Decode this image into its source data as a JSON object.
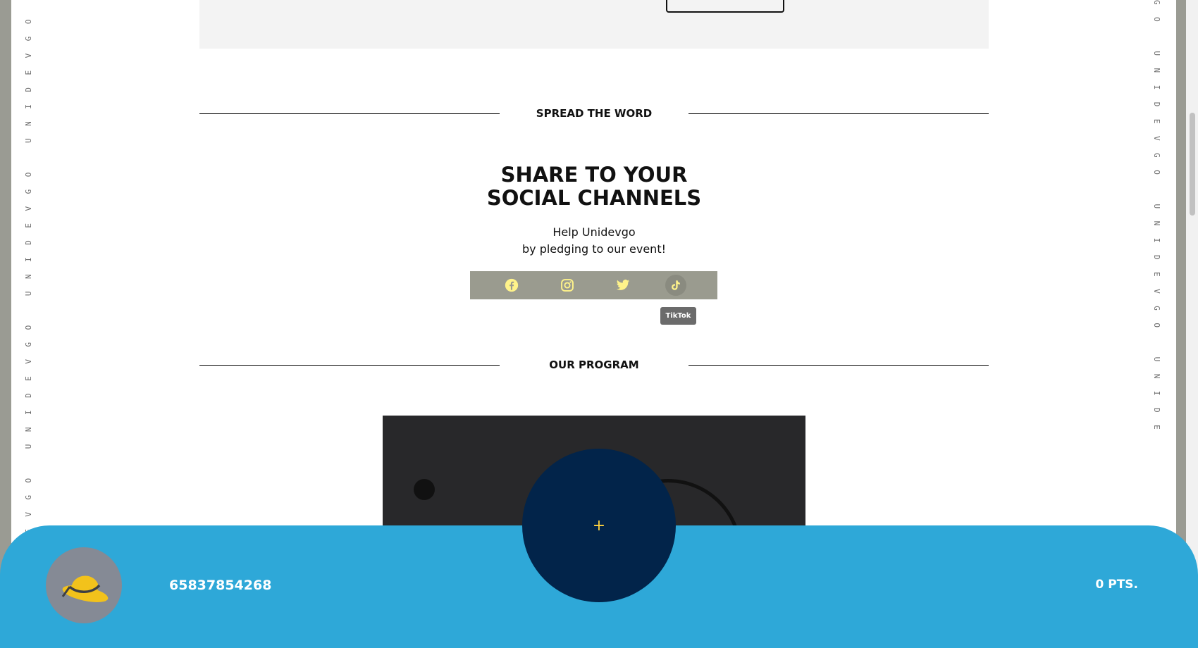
{
  "side_text": {
    "left": "UNIDEVGO UNIDEVGO UNIDEVGO UNIDEVGO",
    "right": "GO UNIDEVGO UNIDEVGO UNIDE"
  },
  "spread_section": {
    "heading": "SPREAD THE WORD"
  },
  "share": {
    "title_line1": "SHARE TO YOUR",
    "title_line2": "SOCIAL CHANNELS",
    "subtitle_line1": "Help Unidevgo",
    "subtitle_line2": "by pledging to our event!"
  },
  "social": {
    "icons": [
      "facebook-icon",
      "instagram-icon",
      "twitter-icon",
      "tiktok-icon"
    ],
    "icon_color": "#fff38a",
    "tooltip": "TikTok"
  },
  "program_section": {
    "heading": "OUR PROGRAM"
  },
  "bottom_bar": {
    "user_id": "65837854268",
    "points": "0 PTS.",
    "add_label": "+",
    "bar_color": "#2ea8d8",
    "button_color": "#02244a"
  }
}
